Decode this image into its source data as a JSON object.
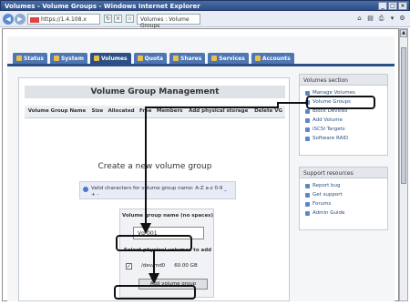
{
  "window": {
    "title": "Volumes - Volume Groups - Windows Internet Explorer",
    "address": "https://1.4.108.x",
    "tab_label": "Volumes : Volume Groups"
  },
  "tabs": [
    {
      "label": "Status",
      "icon": "status-icon"
    },
    {
      "label": "System",
      "icon": "system-icon"
    },
    {
      "label": "Volumes",
      "icon": "volumes-icon",
      "active": true
    },
    {
      "label": "Quota",
      "icon": "quota-icon"
    },
    {
      "label": "Shares",
      "icon": "shares-icon"
    },
    {
      "label": "Services",
      "icon": "services-icon"
    },
    {
      "label": "Accounts",
      "icon": "accounts-icon"
    }
  ],
  "main": {
    "title": "Volume Group Management",
    "columns": [
      "Volume Group Name",
      "Size",
      "Allocated",
      "Free",
      "Members",
      "Add physical storage",
      "Delete VG"
    ],
    "create_title": "Create a new volume group",
    "hint": "Valid characters for volume group name: A-Z a-z 0-9 _ + -",
    "form": {
      "name_label": "Volume group name (no spaces)",
      "name_value": "Vg-001",
      "select_label": "Select physical volumes to add",
      "pv_path": "/dev/md0",
      "pv_size": "60.00 GB",
      "add_button": "Add volume group"
    }
  },
  "sidebar": {
    "section_title": "Volumes section",
    "items": [
      "Manage Volumes",
      "Volume Groups",
      "Block Devices",
      "Add Volume",
      "iSCSI Targets",
      "Software RAID"
    ],
    "support_title": "Support resources",
    "support_items": [
      "Report bug",
      "Get support",
      "Forums",
      "Admin Guide"
    ]
  }
}
